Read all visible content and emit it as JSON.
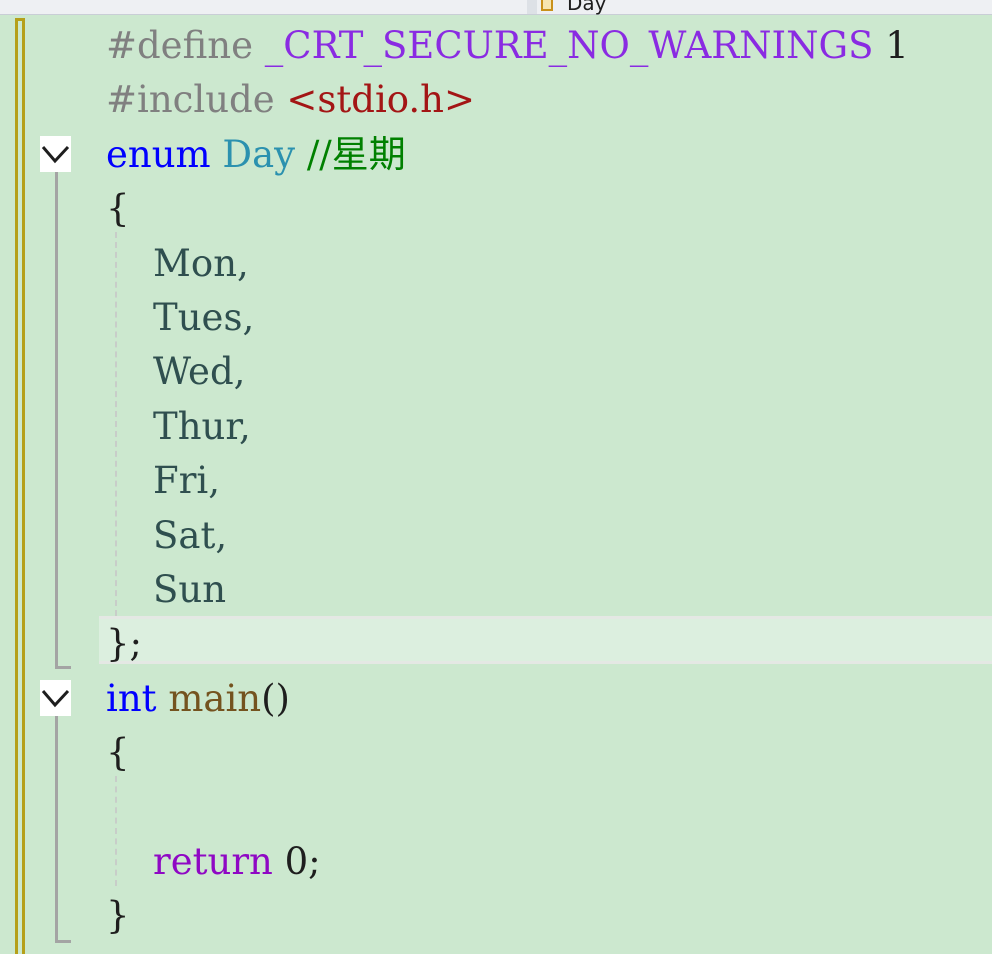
{
  "navigation": {
    "member_label": "Day",
    "member_icon": "enum-icon"
  },
  "code": {
    "define_directive": "#define",
    "define_macro": "_CRT_SECURE_NO_WARNINGS",
    "define_value": "1",
    "include_directive": "#include",
    "include_header": "<stdio.h>",
    "enum_keyword": "enum",
    "enum_name": "Day",
    "enum_comment": "//星期",
    "open_brace": "{",
    "members": [
      "Mon,",
      "Tues,",
      "Wed,",
      "Thur,",
      "Fri,",
      "Sat,",
      "Sun"
    ],
    "enum_close": "};",
    "int_keyword": "int",
    "main_name": "main",
    "main_parens": "()",
    "main_open": "{",
    "return_keyword": "return",
    "return_value": "0",
    "return_semicolon": ";",
    "main_close": "}",
    "next_comment": "//"
  },
  "colors": {
    "background": "#cce8cf",
    "keyword": "#0000ff",
    "type": "#2b91af",
    "comment": "#008000",
    "macro": "#8a2be2",
    "string": "#a31515",
    "control": "#8f08c4"
  }
}
